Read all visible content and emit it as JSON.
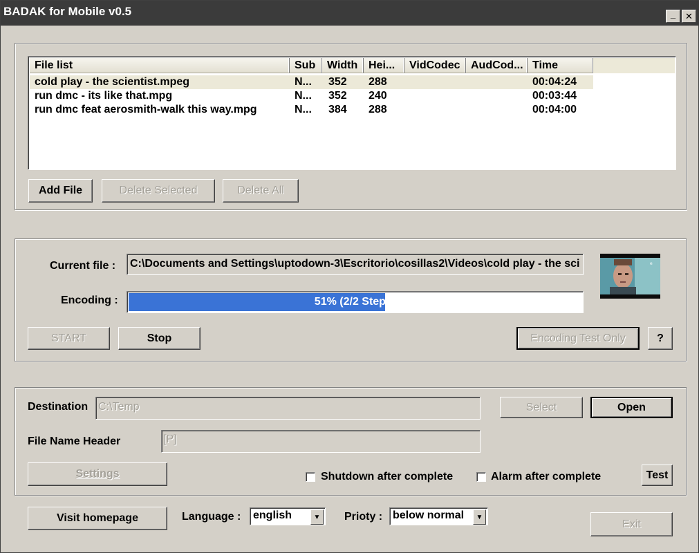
{
  "window": {
    "title": "BADAK for Mobile v0.5",
    "minimize_glyph": "_",
    "close_glyph": "✕"
  },
  "file_list": {
    "columns": [
      "File list",
      "Sub",
      "Width",
      "Hei...",
      "VidCodec",
      "AudCod...",
      "Time"
    ],
    "rows": [
      {
        "name": "cold play - the scientist.mpeg",
        "sub": "N...",
        "width": "352",
        "height": "288",
        "vidcodec": "",
        "audcodec": "",
        "time": "00:04:24",
        "selected": true
      },
      {
        "name": "run dmc - its like that.mpg",
        "sub": "N...",
        "width": "352",
        "height": "240",
        "vidcodec": "",
        "audcodec": "",
        "time": "00:03:44",
        "selected": false
      },
      {
        "name": "run dmc feat aerosmith-walk this way.mpg",
        "sub": "N...",
        "width": "384",
        "height": "288",
        "vidcodec": "",
        "audcodec": "",
        "time": "00:04:00",
        "selected": false
      }
    ],
    "buttons": {
      "add": "Add File",
      "delete_selected": "Delete Selected",
      "delete_all": "Delete All"
    }
  },
  "encoding": {
    "current_file_label": "Current file :",
    "current_file_value": "C:\\Documents and Settings\\uptodown-3\\Escritorio\\cosillas2\\Videos\\cold play - the sci",
    "encoding_label": "Encoding :",
    "progress_text": "51% (2/2 Steps)",
    "progress_fraction": 0.567,
    "buttons": {
      "start": "START",
      "stop": "Stop",
      "test_only": "Encoding Test Only",
      "help": "?"
    }
  },
  "output": {
    "destination_label": "Destination",
    "destination_value": "C:\\Temp",
    "select_button": "Select",
    "open_button": "Open",
    "file_name_header_label": "File Name Header",
    "file_name_header_value": "[P]",
    "settings_button": "Settings",
    "shutdown_label": "Shutdown after complete",
    "alarm_label": "Alarm after complete",
    "test_button": "Test"
  },
  "footer": {
    "visit_homepage": "Visit homepage",
    "language_label": "Language :",
    "language_value": "english",
    "priority_label": "Prioty :",
    "priority_value": "below normal",
    "exit": "Exit"
  }
}
